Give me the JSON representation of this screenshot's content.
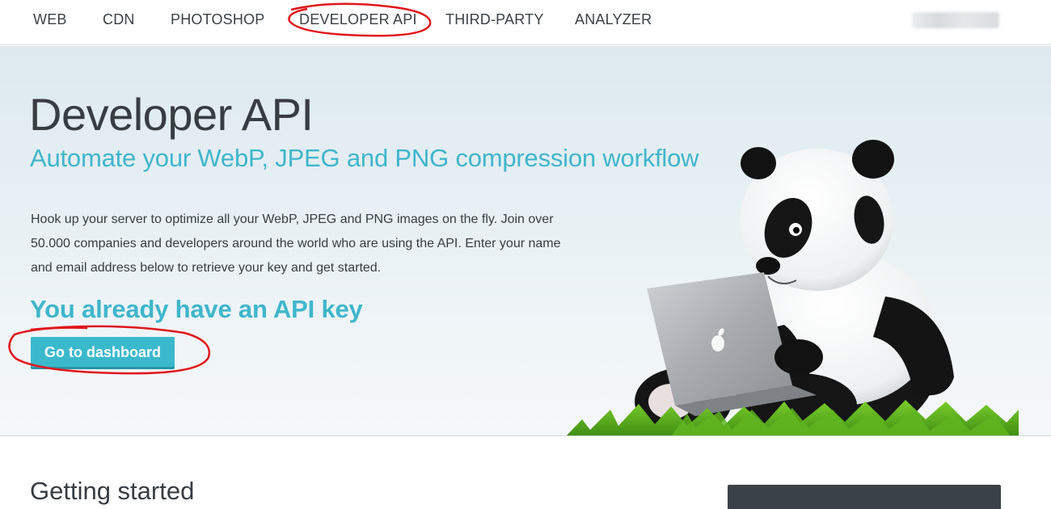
{
  "nav": {
    "items": [
      "WEB",
      "CDN",
      "PHOTOSHOP",
      "DEVELOPER API",
      "THIRD-PARTY",
      "ANALYZER"
    ]
  },
  "hero": {
    "title": "Developer API",
    "subtitle": "Automate your WebP, JPEG and PNG compression workflow",
    "description": "Hook up your server to optimize all your WebP, JPEG and PNG images on the fly. Join over 50.000 companies and developers around the world who are using the API. Enter your name and email address below to retrieve your key and get started.",
    "key_heading": "You already have an API key",
    "dashboard_button": "Go to dashboard"
  },
  "getting_started": {
    "title": "Getting started"
  },
  "colors": {
    "accent": "#3fb6cb",
    "button": "#3bb9cc",
    "text": "#383d42",
    "annotation": "#e0161b"
  },
  "icons": {
    "illustration": "panda-with-laptop"
  }
}
